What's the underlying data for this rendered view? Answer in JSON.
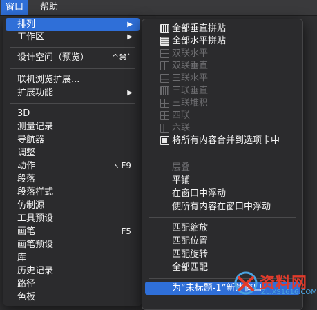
{
  "menubar": {
    "items": [
      {
        "label": "窗口",
        "active": true
      },
      {
        "label": "帮助",
        "active": false
      }
    ]
  },
  "window_menu": {
    "items": [
      {
        "label": "排列",
        "submenu": true,
        "highlighted": true
      },
      {
        "label": "工作区",
        "submenu": true
      },
      {
        "label": "设计空间（预览）",
        "shortcut": "^⌘`"
      },
      {
        "label": "联机浏览扩展..."
      },
      {
        "label": "扩展功能",
        "submenu": true
      },
      {
        "label": "3D"
      },
      {
        "label": "测量记录"
      },
      {
        "label": "导航器"
      },
      {
        "label": "调整"
      },
      {
        "label": "动作",
        "shortcut": "⌥F9"
      },
      {
        "label": "段落"
      },
      {
        "label": "段落样式"
      },
      {
        "label": "仿制源"
      },
      {
        "label": "工具预设"
      },
      {
        "label": "画笔",
        "shortcut": "F5"
      },
      {
        "label": "画笔预设"
      },
      {
        "label": "库"
      },
      {
        "label": "历史记录"
      },
      {
        "label": "路径"
      },
      {
        "label": "色板"
      }
    ]
  },
  "arrange_submenu": {
    "items": [
      {
        "label": "全部垂直拼贴",
        "icon": "tile-vertical-icon",
        "enabled": true
      },
      {
        "label": "全部水平拼贴",
        "icon": "tile-horizontal-icon",
        "enabled": true
      },
      {
        "label": "双联水平",
        "icon": "two-up-horizontal-icon",
        "enabled": false
      },
      {
        "label": "双联垂直",
        "icon": "two-up-vertical-icon",
        "enabled": false
      },
      {
        "label": "三联水平",
        "icon": "three-up-horizontal-icon",
        "enabled": false
      },
      {
        "label": "三联垂直",
        "icon": "three-up-vertical-icon",
        "enabled": false
      },
      {
        "label": "三联堆积",
        "icon": "three-up-stacked-icon",
        "enabled": false
      },
      {
        "label": "四联",
        "icon": "four-up-icon",
        "enabled": false
      },
      {
        "label": "六联",
        "icon": "six-up-icon",
        "enabled": false
      },
      {
        "label": "将所有内容合并到选项卡中",
        "icon": "consolidate-tabs-icon",
        "enabled": true
      },
      {
        "label": "层叠",
        "enabled": false
      },
      {
        "label": "平铺",
        "enabled": true
      },
      {
        "label": "在窗口中浮动",
        "enabled": true
      },
      {
        "label": "使所有内容在窗口中浮动",
        "enabled": true
      },
      {
        "label": "匹配缩放",
        "enabled": true
      },
      {
        "label": "匹配位置",
        "enabled": true
      },
      {
        "label": "匹配旋转",
        "enabled": true
      },
      {
        "label": "全部匹配",
        "enabled": true
      },
      {
        "label": "为“未标题-1”新建窗口",
        "enabled": true,
        "highlighted": true
      }
    ]
  },
  "watermark": {
    "brand": "资料网",
    "url": "ZL.XS1616.COM"
  },
  "colors": {
    "highlight": "#2f6fd8",
    "menu_bg": "#2b2b2d",
    "disabled_text": "#6d6d70",
    "watermark_red": "#e23b2b"
  }
}
